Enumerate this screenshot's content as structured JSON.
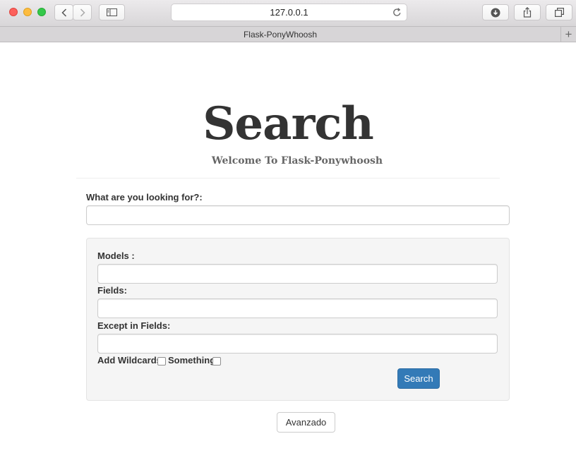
{
  "browser": {
    "url": "127.0.0.1",
    "tab_title": "Flask-PonyWhoosh",
    "new_tab_symbol": "+",
    "icons": [
      "back-icon",
      "forward-icon",
      "sidebar-icon",
      "reload-icon",
      "download-icon",
      "share-icon",
      "tabs-icon"
    ]
  },
  "page": {
    "title": "Search",
    "subtitle": "Welcome To Flask-Ponywhoosh",
    "query_label": "What are you looking for?:",
    "query_value": ""
  },
  "advanced": {
    "models_label": "Models :",
    "models_value": "",
    "fields_label": "Fields:",
    "fields_value": "",
    "except_label": "Except in Fields:",
    "except_value": "",
    "wildcards_label": "Add Wildcards:",
    "wildcards_checked": false,
    "something_label": "Something",
    "something_checked": false,
    "search_button": "Search"
  },
  "toggle_button": "Avanzado",
  "colors": {
    "primary": "#337ab7",
    "well_bg": "#f5f5f5",
    "traffic_red": "#fc605c",
    "traffic_yellow": "#fdbc40",
    "traffic_green": "#34c84a"
  }
}
